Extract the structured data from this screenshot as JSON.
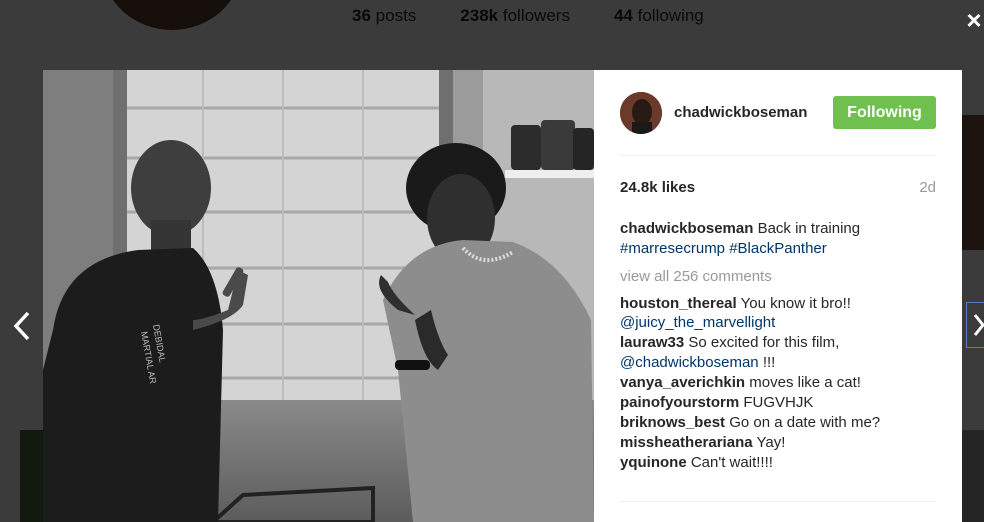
{
  "background_page": {
    "stats": [
      {
        "count": "36",
        "label": "posts"
      },
      {
        "count": "238k",
        "label": "followers"
      },
      {
        "count": "44",
        "label": "following"
      }
    ]
  },
  "modal": {
    "close_icon": "×",
    "post": {
      "username": "chadwickboseman",
      "follow_button": "Following",
      "likes": "24.8k likes",
      "age": "2d",
      "caption": {
        "user": "chadwickboseman",
        "text": "Back in training",
        "tags": [
          "#marresecrump",
          "#BlackPanther"
        ]
      },
      "view_all": "view all 256 comments",
      "comments": [
        {
          "user": "houston_thereal",
          "text": "You know it bro!!",
          "mention": "@juicy_the_marvellight"
        },
        {
          "user": "lauraw33",
          "text": "So excited for this film,",
          "mention": "@chadwickboseman",
          "suffix": "!!!"
        },
        {
          "user": "vanya_averichkin",
          "text": "moves like a cat!"
        },
        {
          "user": "painofyourstorm",
          "text": "FUGVHJK"
        },
        {
          "user": "briknows_best",
          "text": "Go on a date with me?"
        },
        {
          "user": "missheatherariana",
          "text": "Yay!"
        },
        {
          "user": "yquinone",
          "text": "Can't wait!!!!"
        }
      ]
    },
    "photo": {
      "shirt_text_line1": "DEBIDAL",
      "shirt_text_line2": "MARTIAL AR"
    }
  },
  "colors": {
    "follow_green": "#70c050",
    "link_blue": "#003569",
    "muted_gray": "#999999"
  },
  "icons": {
    "close": "close-icon",
    "prev": "chevron-left-icon",
    "next": "chevron-right-icon"
  }
}
